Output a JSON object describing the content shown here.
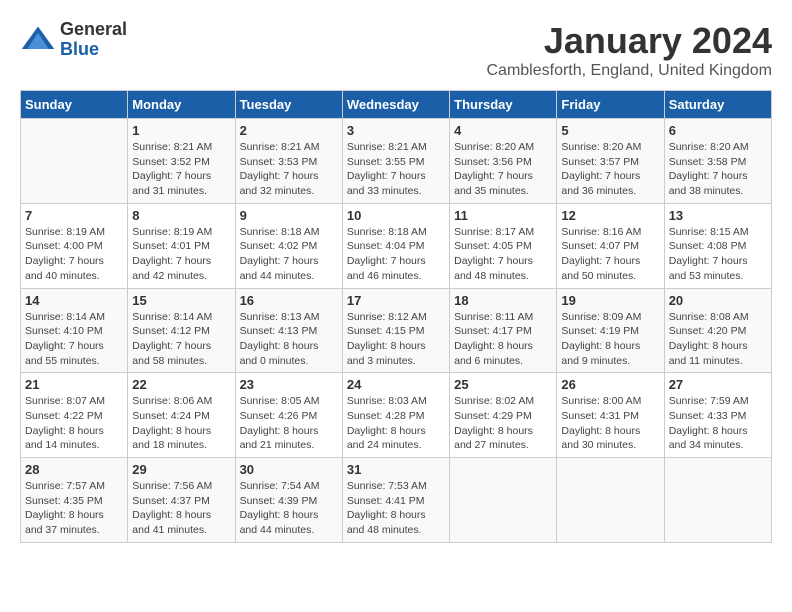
{
  "logo": {
    "line1": "General",
    "line2": "Blue"
  },
  "title": "January 2024",
  "subtitle": "Camblesforth, England, United Kingdom",
  "weekdays": [
    "Sunday",
    "Monday",
    "Tuesday",
    "Wednesday",
    "Thursday",
    "Friday",
    "Saturday"
  ],
  "weeks": [
    [
      {
        "day": "",
        "info": ""
      },
      {
        "day": "1",
        "info": "Sunrise: 8:21 AM\nSunset: 3:52 PM\nDaylight: 7 hours\nand 31 minutes."
      },
      {
        "day": "2",
        "info": "Sunrise: 8:21 AM\nSunset: 3:53 PM\nDaylight: 7 hours\nand 32 minutes."
      },
      {
        "day": "3",
        "info": "Sunrise: 8:21 AM\nSunset: 3:55 PM\nDaylight: 7 hours\nand 33 minutes."
      },
      {
        "day": "4",
        "info": "Sunrise: 8:20 AM\nSunset: 3:56 PM\nDaylight: 7 hours\nand 35 minutes."
      },
      {
        "day": "5",
        "info": "Sunrise: 8:20 AM\nSunset: 3:57 PM\nDaylight: 7 hours\nand 36 minutes."
      },
      {
        "day": "6",
        "info": "Sunrise: 8:20 AM\nSunset: 3:58 PM\nDaylight: 7 hours\nand 38 minutes."
      }
    ],
    [
      {
        "day": "7",
        "info": "Sunrise: 8:19 AM\nSunset: 4:00 PM\nDaylight: 7 hours\nand 40 minutes."
      },
      {
        "day": "8",
        "info": "Sunrise: 8:19 AM\nSunset: 4:01 PM\nDaylight: 7 hours\nand 42 minutes."
      },
      {
        "day": "9",
        "info": "Sunrise: 8:18 AM\nSunset: 4:02 PM\nDaylight: 7 hours\nand 44 minutes."
      },
      {
        "day": "10",
        "info": "Sunrise: 8:18 AM\nSunset: 4:04 PM\nDaylight: 7 hours\nand 46 minutes."
      },
      {
        "day": "11",
        "info": "Sunrise: 8:17 AM\nSunset: 4:05 PM\nDaylight: 7 hours\nand 48 minutes."
      },
      {
        "day": "12",
        "info": "Sunrise: 8:16 AM\nSunset: 4:07 PM\nDaylight: 7 hours\nand 50 minutes."
      },
      {
        "day": "13",
        "info": "Sunrise: 8:15 AM\nSunset: 4:08 PM\nDaylight: 7 hours\nand 53 minutes."
      }
    ],
    [
      {
        "day": "14",
        "info": "Sunrise: 8:14 AM\nSunset: 4:10 PM\nDaylight: 7 hours\nand 55 minutes."
      },
      {
        "day": "15",
        "info": "Sunrise: 8:14 AM\nSunset: 4:12 PM\nDaylight: 7 hours\nand 58 minutes."
      },
      {
        "day": "16",
        "info": "Sunrise: 8:13 AM\nSunset: 4:13 PM\nDaylight: 8 hours\nand 0 minutes."
      },
      {
        "day": "17",
        "info": "Sunrise: 8:12 AM\nSunset: 4:15 PM\nDaylight: 8 hours\nand 3 minutes."
      },
      {
        "day": "18",
        "info": "Sunrise: 8:11 AM\nSunset: 4:17 PM\nDaylight: 8 hours\nand 6 minutes."
      },
      {
        "day": "19",
        "info": "Sunrise: 8:09 AM\nSunset: 4:19 PM\nDaylight: 8 hours\nand 9 minutes."
      },
      {
        "day": "20",
        "info": "Sunrise: 8:08 AM\nSunset: 4:20 PM\nDaylight: 8 hours\nand 11 minutes."
      }
    ],
    [
      {
        "day": "21",
        "info": "Sunrise: 8:07 AM\nSunset: 4:22 PM\nDaylight: 8 hours\nand 14 minutes."
      },
      {
        "day": "22",
        "info": "Sunrise: 8:06 AM\nSunset: 4:24 PM\nDaylight: 8 hours\nand 18 minutes."
      },
      {
        "day": "23",
        "info": "Sunrise: 8:05 AM\nSunset: 4:26 PM\nDaylight: 8 hours\nand 21 minutes."
      },
      {
        "day": "24",
        "info": "Sunrise: 8:03 AM\nSunset: 4:28 PM\nDaylight: 8 hours\nand 24 minutes."
      },
      {
        "day": "25",
        "info": "Sunrise: 8:02 AM\nSunset: 4:29 PM\nDaylight: 8 hours\nand 27 minutes."
      },
      {
        "day": "26",
        "info": "Sunrise: 8:00 AM\nSunset: 4:31 PM\nDaylight: 8 hours\nand 30 minutes."
      },
      {
        "day": "27",
        "info": "Sunrise: 7:59 AM\nSunset: 4:33 PM\nDaylight: 8 hours\nand 34 minutes."
      }
    ],
    [
      {
        "day": "28",
        "info": "Sunrise: 7:57 AM\nSunset: 4:35 PM\nDaylight: 8 hours\nand 37 minutes."
      },
      {
        "day": "29",
        "info": "Sunrise: 7:56 AM\nSunset: 4:37 PM\nDaylight: 8 hours\nand 41 minutes."
      },
      {
        "day": "30",
        "info": "Sunrise: 7:54 AM\nSunset: 4:39 PM\nDaylight: 8 hours\nand 44 minutes."
      },
      {
        "day": "31",
        "info": "Sunrise: 7:53 AM\nSunset: 4:41 PM\nDaylight: 8 hours\nand 48 minutes."
      },
      {
        "day": "",
        "info": ""
      },
      {
        "day": "",
        "info": ""
      },
      {
        "day": "",
        "info": ""
      }
    ]
  ]
}
